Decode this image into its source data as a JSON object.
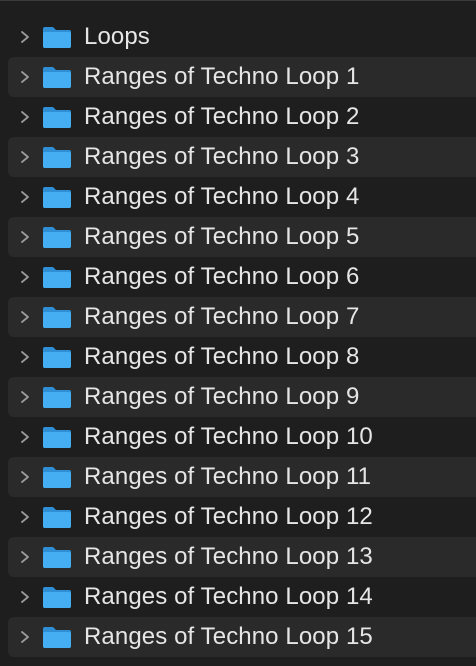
{
  "folders": [
    {
      "label": "Loops",
      "icon": "folder-icon"
    },
    {
      "label": "Ranges of Techno Loop 1",
      "icon": "folder-icon"
    },
    {
      "label": "Ranges of Techno Loop 2",
      "icon": "folder-icon"
    },
    {
      "label": "Ranges of Techno Loop 3",
      "icon": "folder-icon"
    },
    {
      "label": "Ranges of Techno Loop 4",
      "icon": "folder-icon"
    },
    {
      "label": "Ranges of Techno Loop 5",
      "icon": "folder-icon"
    },
    {
      "label": "Ranges of Techno Loop 6",
      "icon": "folder-icon"
    },
    {
      "label": "Ranges of Techno Loop 7",
      "icon": "folder-icon"
    },
    {
      "label": "Ranges of Techno Loop 8",
      "icon": "folder-icon"
    },
    {
      "label": "Ranges of Techno Loop 9",
      "icon": "folder-icon"
    },
    {
      "label": "Ranges of Techno Loop 10",
      "icon": "folder-icon"
    },
    {
      "label": "Ranges of Techno Loop 11",
      "icon": "folder-icon"
    },
    {
      "label": "Ranges of Techno Loop 12",
      "icon": "folder-icon"
    },
    {
      "label": "Ranges of Techno Loop 13",
      "icon": "folder-icon"
    },
    {
      "label": "Ranges of Techno Loop 14",
      "icon": "folder-icon"
    },
    {
      "label": "Ranges of Techno Loop 15",
      "icon": "folder-icon"
    }
  ],
  "colors": {
    "background": "#1e1e1e",
    "row_alt": "#2a2a2a",
    "folder_blue": "#3fa9f5",
    "text": "#e6e6e6",
    "chevron": "#9a9a9a"
  }
}
